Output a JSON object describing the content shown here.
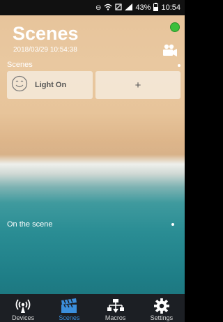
{
  "status": {
    "battery_percent": "43%",
    "time": "10:54"
  },
  "header": {
    "title": "Scenes",
    "datetime": "2018/03/29 10:54:38"
  },
  "section1": {
    "label": "Scenes"
  },
  "cards": {
    "light_on_label": "Light On",
    "add_label": "+"
  },
  "section2": {
    "label": "On the scene"
  },
  "nav": {
    "devices": "Devices",
    "scenes": "Scenes",
    "macros": "Macros",
    "settings": "Settings"
  },
  "colors": {
    "active_tab": "#3b8fdc",
    "connected": "#3bbf3b"
  }
}
